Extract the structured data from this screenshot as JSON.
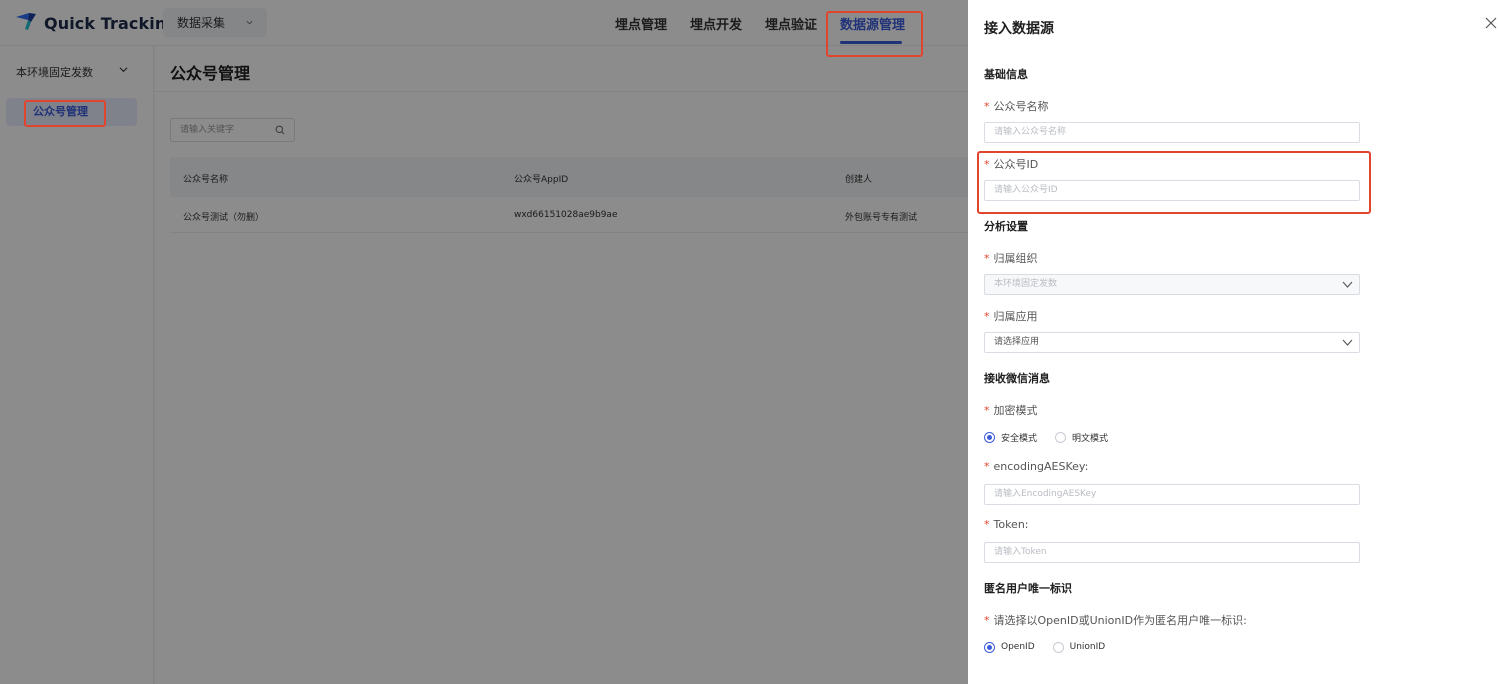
{
  "app": {
    "name": "Quick Tracking",
    "module_select": "数据采集"
  },
  "nav": {
    "items": [
      "埋点管理",
      "埋点开发",
      "埋点验证",
      "数据源管理"
    ],
    "active_index": 3
  },
  "sidebar": {
    "env_select": "本环境固定发数",
    "items": [
      {
        "label": "公众号管理"
      }
    ]
  },
  "main": {
    "title": "公众号管理",
    "search_placeholder": "请输入关键字",
    "table": {
      "columns": [
        "公众号名称",
        "公众号AppID",
        "创建人"
      ],
      "rows": [
        [
          "公众号测试（勿删）",
          "wxd66151028ae9b9ae",
          "外包账号专有测试"
        ]
      ]
    }
  },
  "drawer": {
    "title": "接入数据源",
    "sections": {
      "basic": "基础信息",
      "analysis": "分析设置",
      "wechat": "接收微信消息",
      "anonymous": "匿名用户唯一标识"
    },
    "fields": {
      "account_name": {
        "label": "公众号名称",
        "placeholder": "请输入公众号名称"
      },
      "account_id": {
        "label": "公众号ID",
        "placeholder": "请输入公众号ID"
      },
      "org": {
        "label": "归属组织",
        "value": "本环境固定发数"
      },
      "app": {
        "label": "归属应用",
        "value": "请选择应用"
      },
      "encrypt_mode": {
        "label": "加密模式",
        "options": [
          "安全模式",
          "明文模式"
        ],
        "selected": 0
      },
      "aes_key": {
        "label": "encodingAESKey:",
        "placeholder": "请输入EncodingAESKey"
      },
      "token": {
        "label": "Token:",
        "placeholder": "请输入Token"
      },
      "id_type": {
        "label": "请选择以OpenID或UnionID作为匿名用户唯一标识:",
        "options": [
          "OpenID",
          "UnionID"
        ],
        "selected": 0
      }
    }
  },
  "colors": {
    "accent": "#3b5bdb",
    "annotation": "#e2452e",
    "required": "#e2452e"
  }
}
